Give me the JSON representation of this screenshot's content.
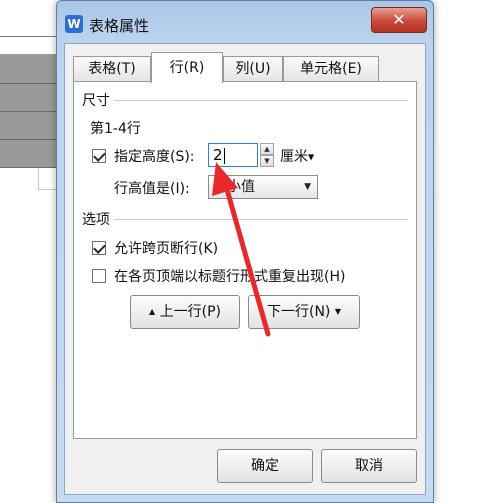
{
  "dialog": {
    "title": "表格属性",
    "app_icon_letter": "W",
    "close_symbol": "✕"
  },
  "tabs": [
    {
      "label": "表格(T)",
      "active": false
    },
    {
      "label": "行(R)",
      "active": true
    },
    {
      "label": "列(U)",
      "active": false
    },
    {
      "label": "单元格(E)",
      "active": false
    }
  ],
  "size_section": {
    "label": "尺寸",
    "rows_label": "第1-4行",
    "specify_height_label": "指定高度(S):",
    "specify_height_checked": true,
    "height_value": "2",
    "unit_label": "厘米",
    "row_height_is_label": "行高值是(I):",
    "row_height_mode": "最小值"
  },
  "options_section": {
    "label": "选项",
    "allow_break_label": "允许跨页断行(K)",
    "allow_break_checked": true,
    "repeat_header_label": "在各页顶端以标题行形式重复出现(H)",
    "repeat_header_checked": false
  },
  "nav": {
    "prev_label": "上一行(P)",
    "next_label": "下一行(N)"
  },
  "footer": {
    "ok_label": "确定",
    "cancel_label": "取消"
  },
  "colors": {
    "annotation_arrow": "#e8282b",
    "accent": "#2f7fd7"
  }
}
